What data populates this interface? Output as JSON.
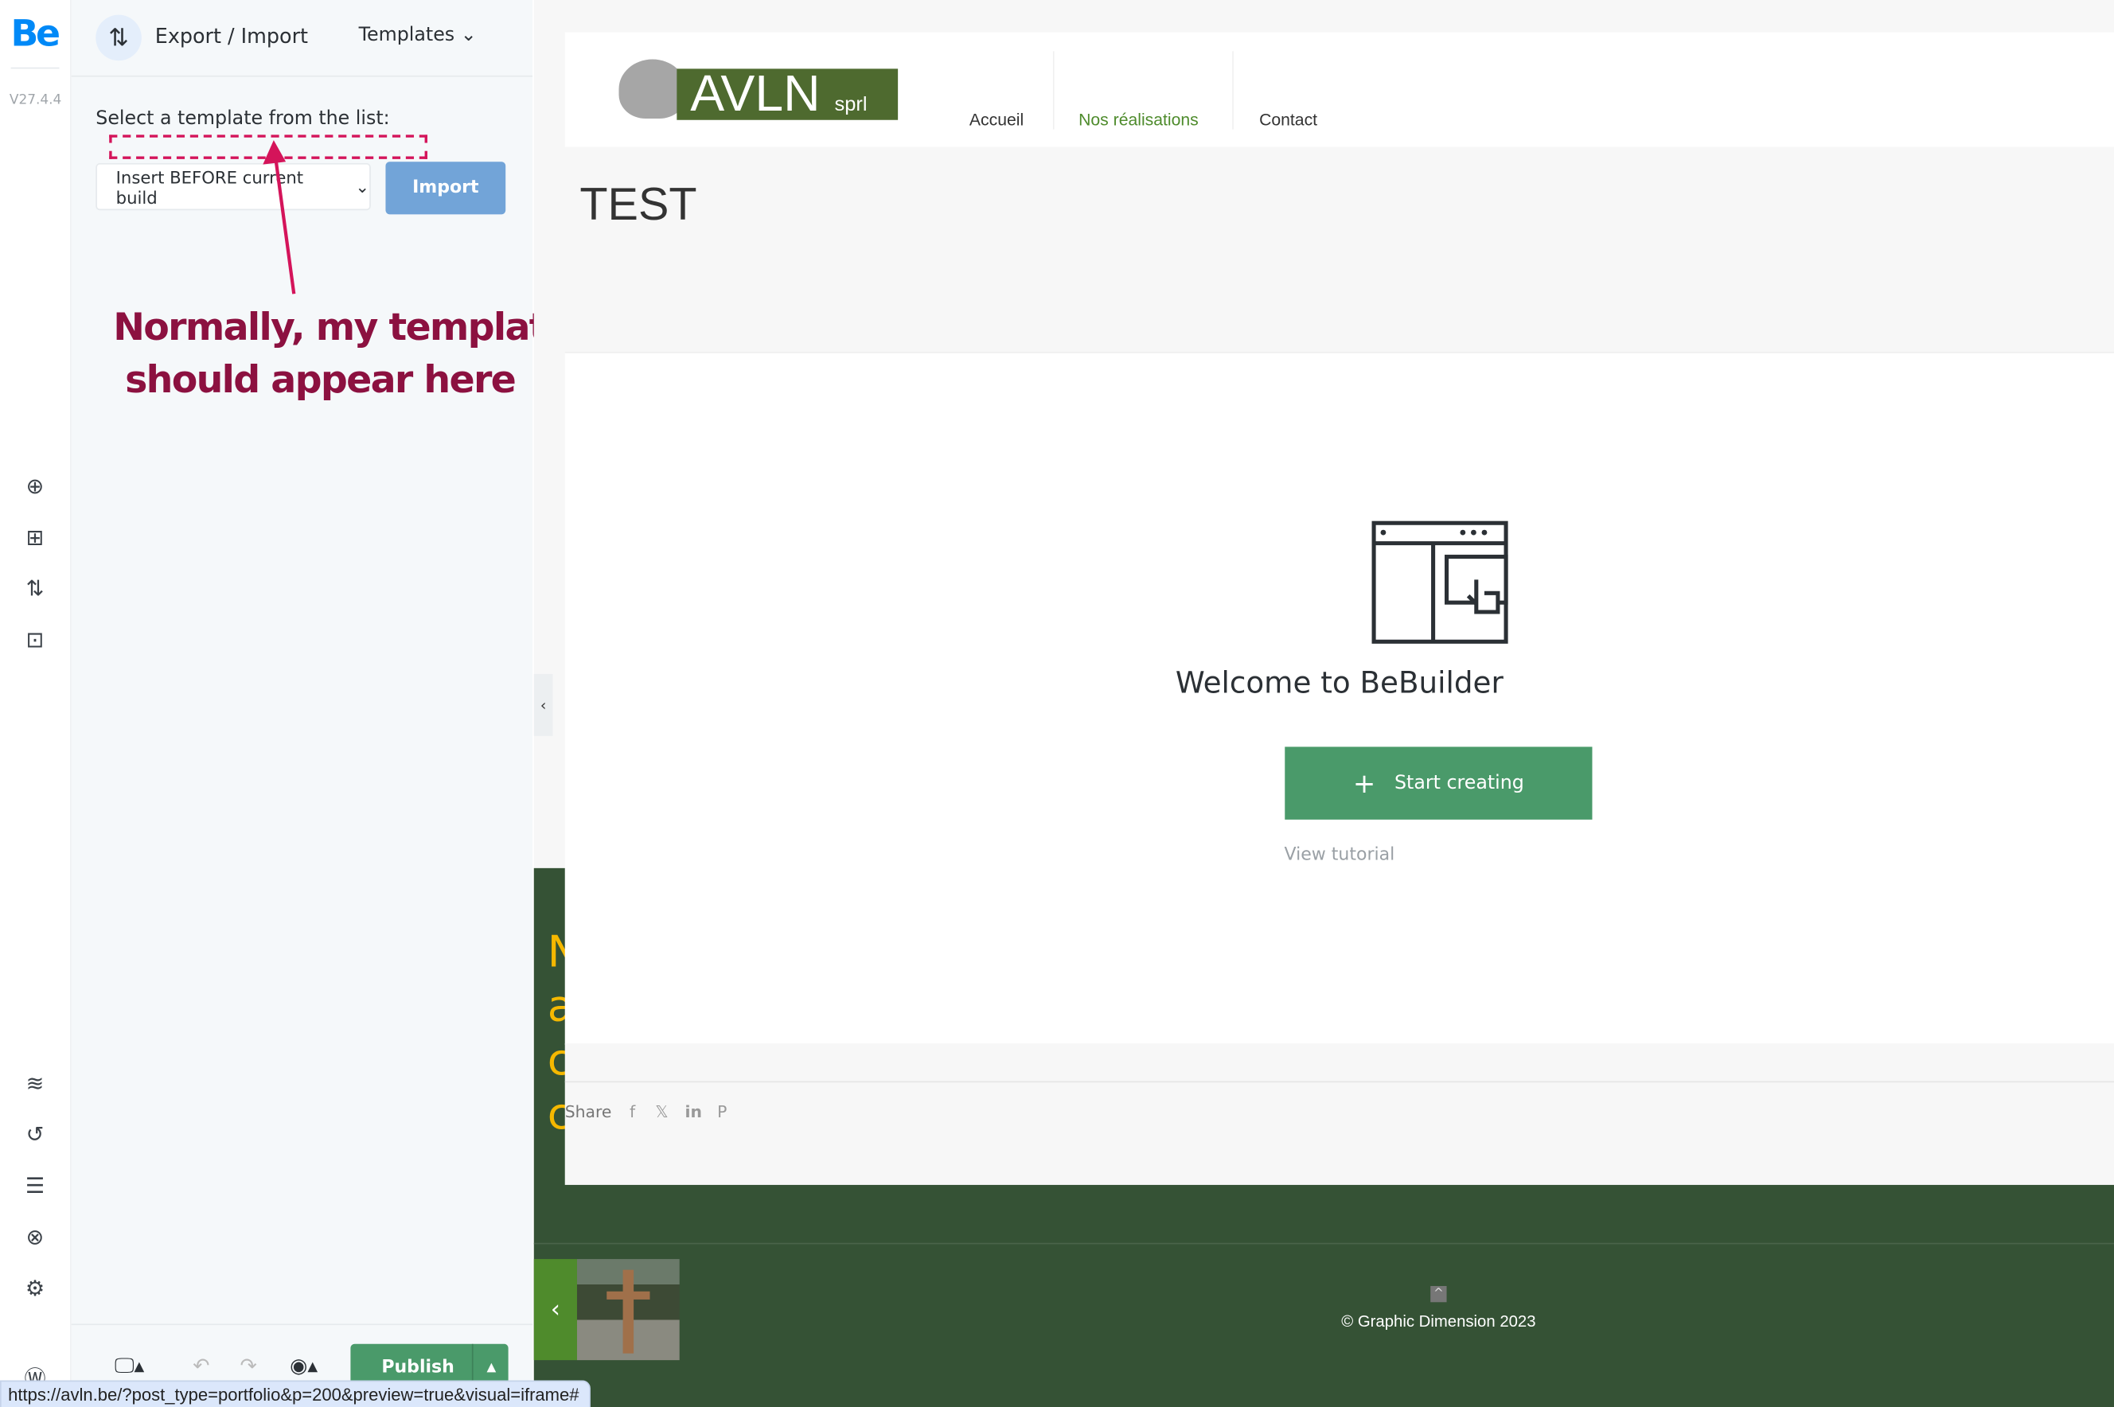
{
  "builder": {
    "logo": "Be",
    "version": "V27.4.4",
    "rail_icons": [
      "add-circle-icon",
      "layout-add-icon",
      "export-import-icon",
      "page-templates-icon",
      "layers-icon",
      "history-icon",
      "settings-sliders-icon",
      "globe-icon",
      "gear-icon",
      "wordpress-icon"
    ],
    "panel": {
      "title": "Export / Import",
      "dropdown": "Templates",
      "select_label": "Select a template from the list:",
      "insert_option": "Insert BEFORE current build",
      "import_label": "Import"
    },
    "annotation": "Normally, my templates\n should appear here",
    "annotation_color": "#d4145a",
    "footer": {
      "publish_label": "Publish"
    }
  },
  "site": {
    "logo_text": "AVLN",
    "logo_sub": "sprl",
    "nav": [
      "Accueil",
      "Nos réalisations",
      "Contact"
    ],
    "nav_active_color": "#4e8b2c",
    "page_title": "TEST",
    "welcome": "Welcome to BeBuilder",
    "start_label": "Start creating",
    "tutorial_label": "View tutorial",
    "side_text": "N a c c",
    "share_label": "Share",
    "social": [
      "f",
      "𝕏",
      "in",
      "P"
    ],
    "copyright": "© Graphic Dimension 2023"
  },
  "status_url": "https://avln.be/?post_type=portfolio&p=200&preview=true&visual=iframe#"
}
